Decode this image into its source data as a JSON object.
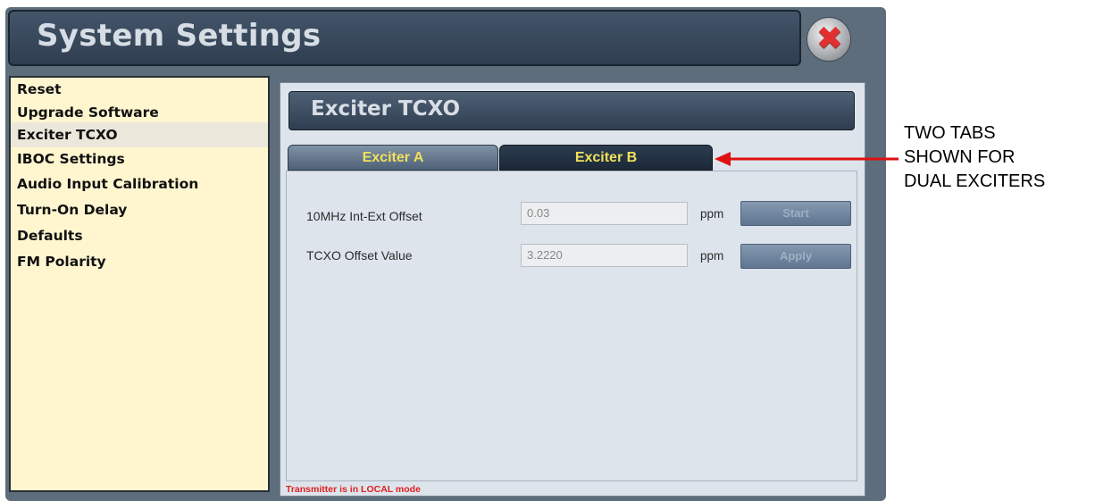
{
  "window": {
    "title": "System Settings",
    "close_icon": "✖"
  },
  "sidebar": {
    "items": [
      {
        "label": "Reset"
      },
      {
        "label": "Upgrade Software"
      },
      {
        "label": "Exciter TCXO"
      },
      {
        "label": "IBOC Settings"
      },
      {
        "label": "Audio Input Calibration"
      },
      {
        "label": "Turn-On Delay"
      },
      {
        "label": "Defaults"
      },
      {
        "label": "FM Polarity"
      }
    ]
  },
  "panel": {
    "title": "Exciter TCXO",
    "tabs": [
      {
        "label": "Exciter A"
      },
      {
        "label": "Exciter B"
      }
    ],
    "rows": [
      {
        "label": "10MHz Int-Ext Offset",
        "value": "0.03",
        "unit": "ppm",
        "button": "Start"
      },
      {
        "label": "TCXO Offset Value",
        "value": "3.2220",
        "unit": "ppm",
        "button": "Apply"
      }
    ],
    "status": "Transmitter is in LOCAL mode"
  },
  "annotation": {
    "lines": [
      "TWO TABS",
      "SHOWN FOR",
      "DUAL EXCITERS"
    ]
  },
  "colors": {
    "sidebar_bg": "#fff6d0",
    "tab_label": "#f1e05a",
    "status_text": "#e02020",
    "arrow": "#e01010"
  }
}
